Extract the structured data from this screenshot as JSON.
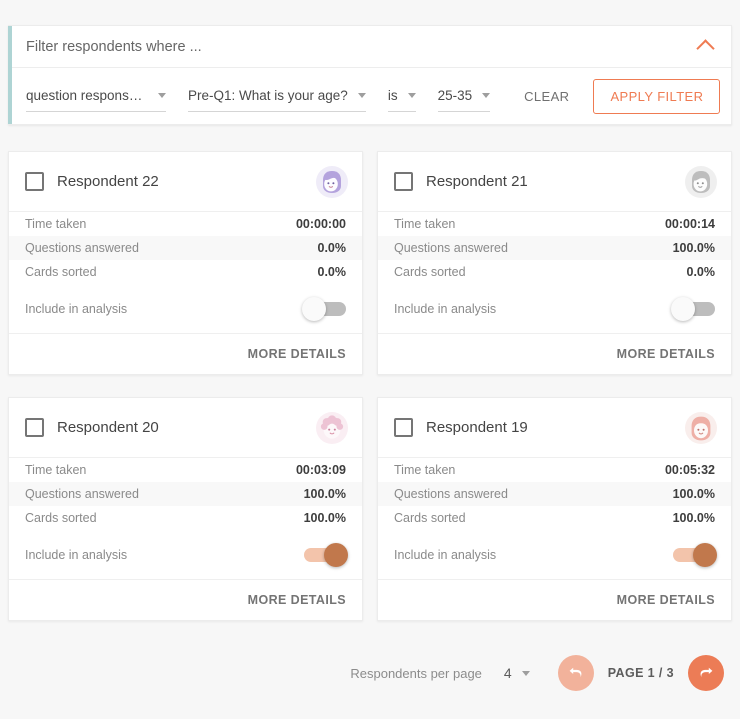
{
  "filter": {
    "title": "Filter respondents where ...",
    "collapse_icon": "chevron-up-icon",
    "accent_color": "#aed4d4",
    "fields": [
      {
        "name": "criteria-type",
        "value": "question response to"
      },
      {
        "name": "question",
        "value": "Pre-Q1: What is your age?"
      },
      {
        "name": "operator",
        "value": "is"
      },
      {
        "name": "answer",
        "value": "25-35"
      }
    ],
    "clear_label": "CLEAR",
    "apply_label": "APPLY FILTER",
    "accent_button_color": "#ef7b52"
  },
  "cards": {
    "labels": {
      "time_taken": "Time taken",
      "questions_answered": "Questions answered",
      "cards_sorted": "Cards sorted",
      "include_in_analysis": "Include in analysis",
      "more_details": "MORE DETAILS"
    },
    "items": [
      {
        "title": "Respondent 22",
        "avatar": "avatar-purple-icon",
        "avatar_color": "#b4a3dd",
        "time_taken": "00:00:00",
        "questions_answered": "0.0%",
        "cards_sorted": "0.0%",
        "include_in_analysis": "off"
      },
      {
        "title": "Respondent 21",
        "avatar": "avatar-gray-icon",
        "avatar_color": "#bdbdbd",
        "time_taken": "00:00:14",
        "questions_answered": "100.0%",
        "cards_sorted": "0.0%",
        "include_in_analysis": "off"
      },
      {
        "title": "Respondent 20",
        "avatar": "avatar-pink-curly-icon",
        "avatar_color": "#edc3d4",
        "time_taken": "00:03:09",
        "questions_answered": "100.0%",
        "cards_sorted": "100.0%",
        "include_in_analysis": "on"
      },
      {
        "title": "Respondent 19",
        "avatar": "avatar-salmon-icon",
        "avatar_color": "#eeafa6",
        "time_taken": "00:05:32",
        "questions_answered": "100.0%",
        "cards_sorted": "100.0%",
        "include_in_analysis": "on"
      }
    ]
  },
  "pagination": {
    "per_page_label": "Respondents per page",
    "per_page_value": "4",
    "page_indicator": "PAGE 1 / 3",
    "prev_icon": "undo-arrow-icon",
    "next_icon": "redo-arrow-icon",
    "prev_color": "#f2b29b",
    "next_color": "#ec7c56"
  }
}
